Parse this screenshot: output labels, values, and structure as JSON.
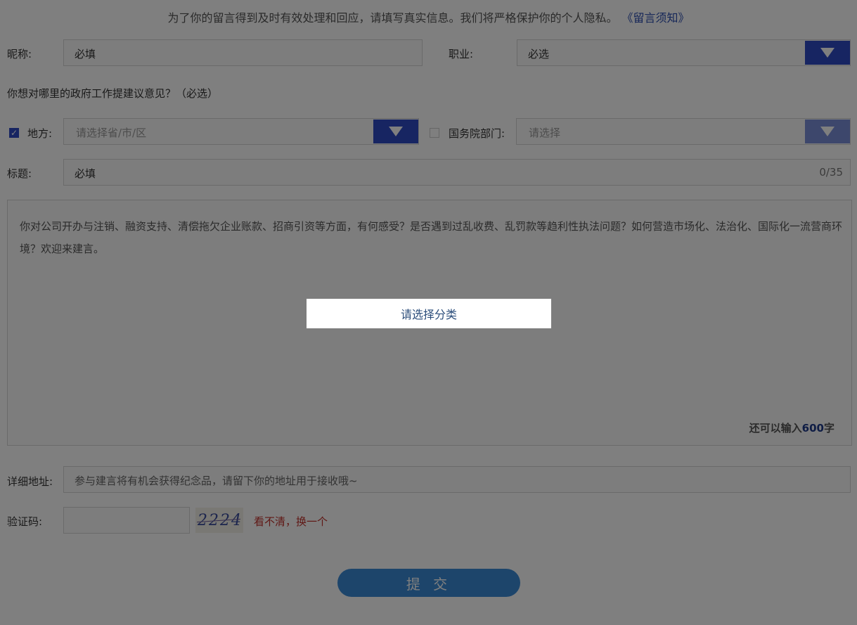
{
  "notice": {
    "text": "为了你的留言得到及时有效处理和回应，请填写真实信息。我们将严格保护你的个人隐私。",
    "link": "《留言须知》"
  },
  "nickname": {
    "label": "昵称:",
    "value": "必填"
  },
  "occupation": {
    "label": "职业:",
    "placeholder": "必选"
  },
  "question": "你想对哪里的政府工作提建议意见？（必选）",
  "local": {
    "label": "地方:",
    "placeholder": "请选择省/市/区",
    "checked": true
  },
  "state_council": {
    "label": "国务院部门:",
    "placeholder": "请选择",
    "checked": false
  },
  "title_field": {
    "label": "标题:",
    "value": "必填",
    "counter": "0/35"
  },
  "content": {
    "placeholder": "你对公司开办与注销、融资支持、清偿拖欠企业账款、招商引资等方面，有何感受？是否遇到过乱收费、乱罚款等趋利性执法问题？如何营造市场化、法治化、国际化一流营商环境？欢迎来建言。",
    "counter_prefix": "还可以输入",
    "counter_value": "600",
    "counter_suffix": "字"
  },
  "address": {
    "label": "详细地址:",
    "placeholder": "参与建言将有机会获得纪念品，请留下你的地址用于接收哦~"
  },
  "captcha": {
    "label": "验证码:",
    "image_text": "2224",
    "refresh": "看不清，换一个"
  },
  "submit": "提 交",
  "modal": {
    "text": "请选择分类"
  },
  "colors": {
    "accent": "#2e4bc4",
    "submit": "#3a8ad6",
    "link": "#2b4cb0",
    "refresh": "#c0302a"
  }
}
